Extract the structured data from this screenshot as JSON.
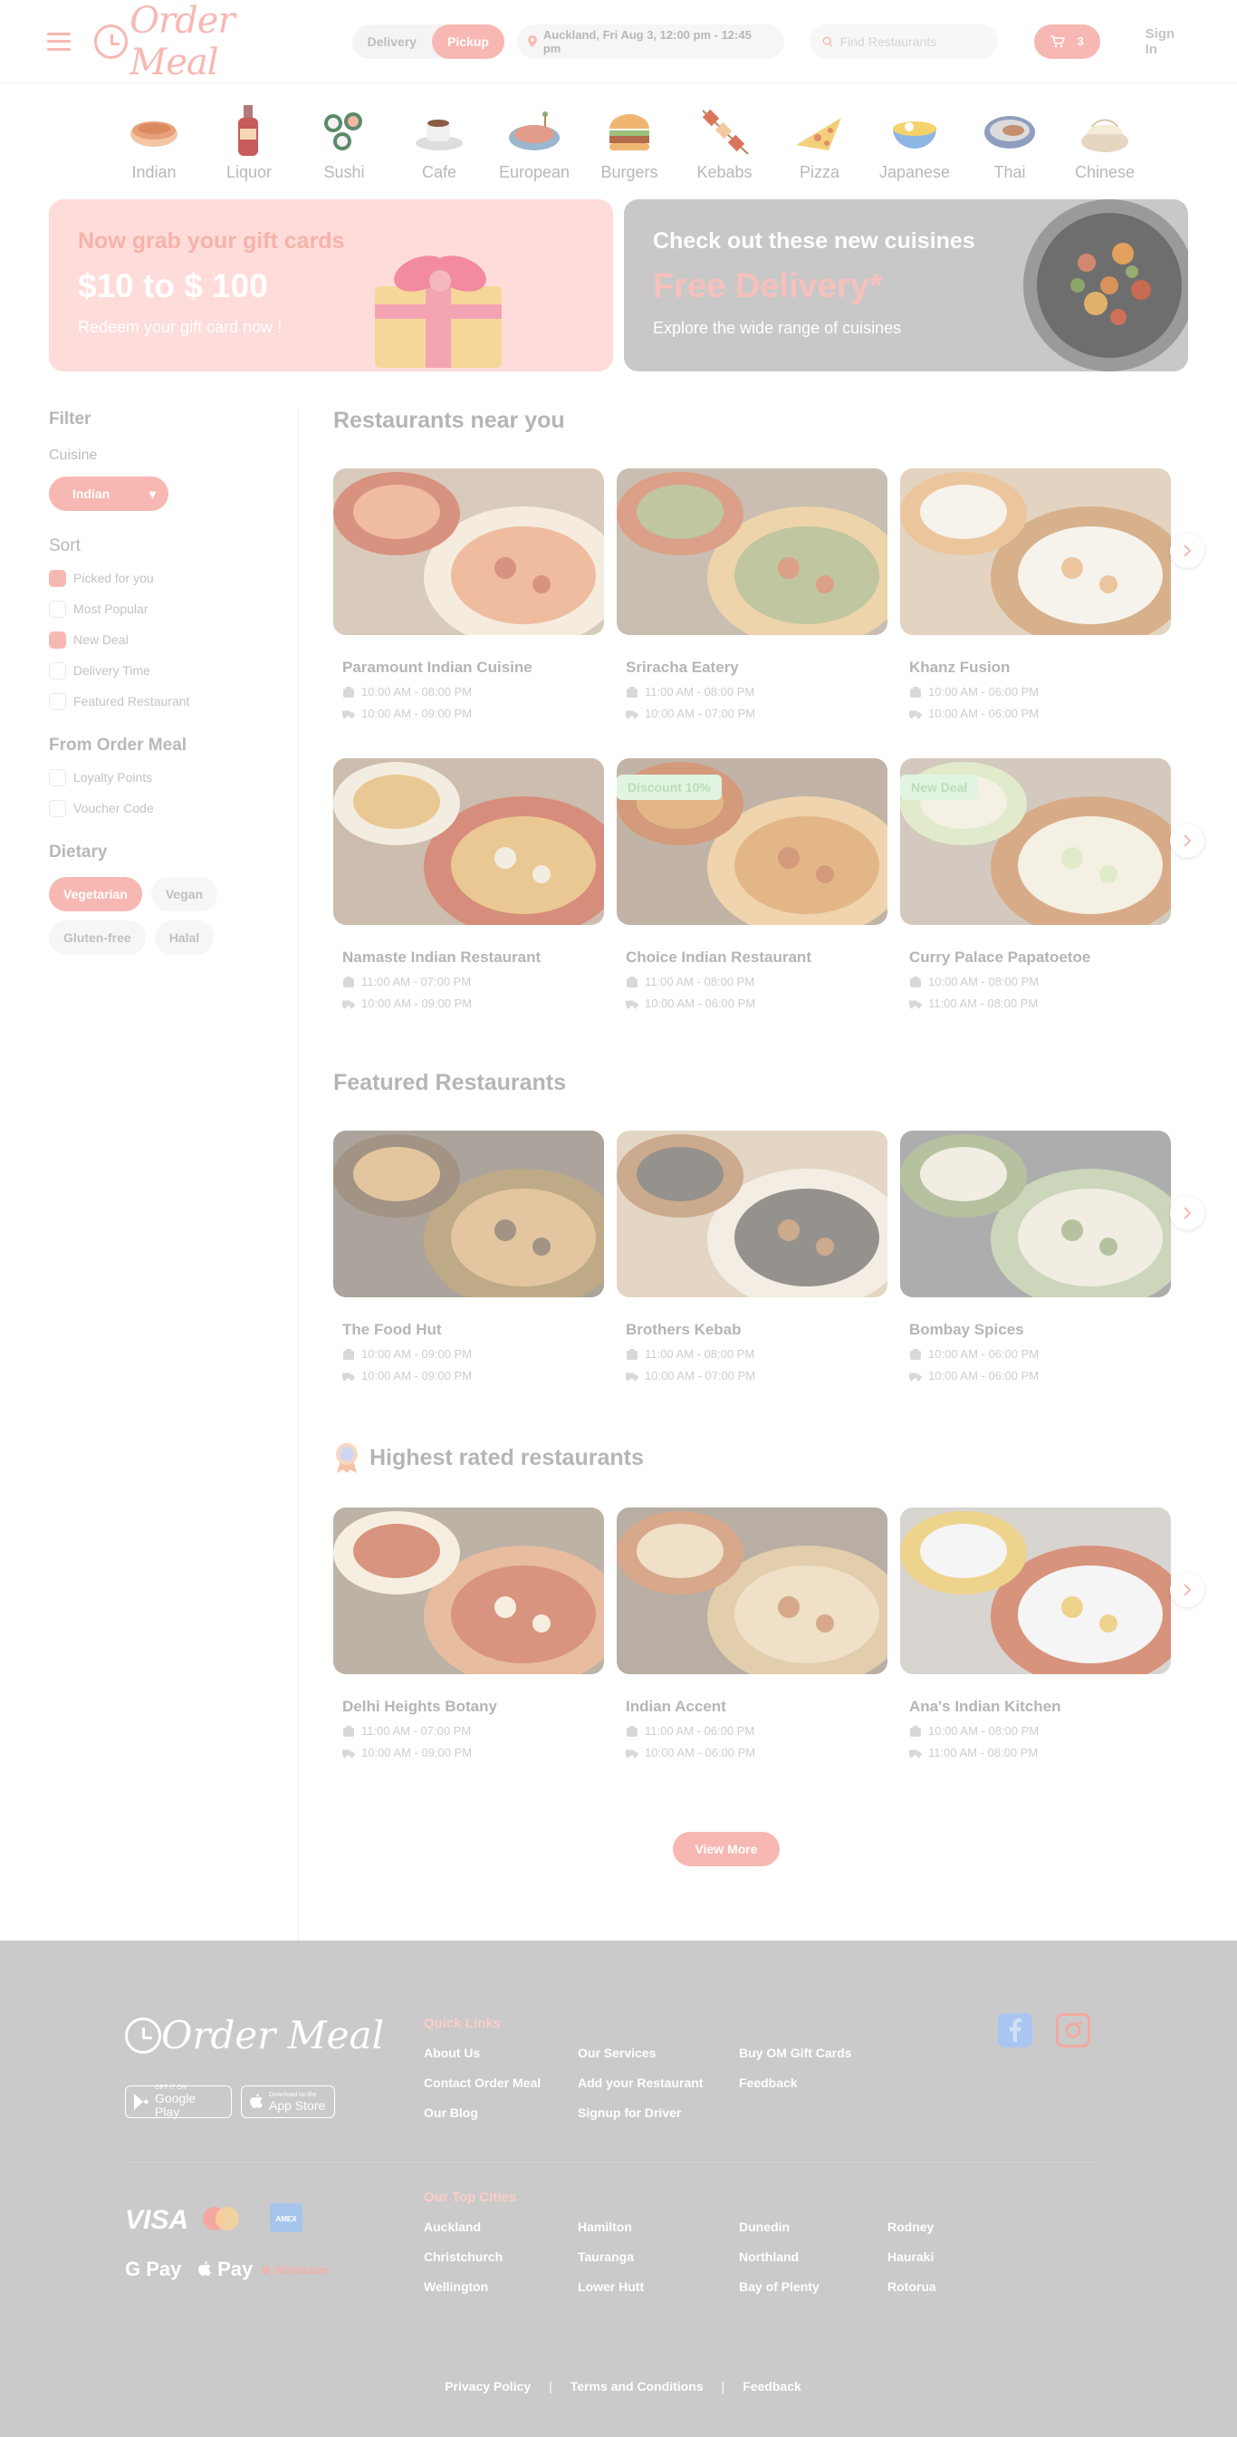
{
  "header": {
    "brand": "Order Meal",
    "delivery_label": "Delivery",
    "pickup_label": "Pickup",
    "location": "Auckland, Fri Aug 3, 12:00 pm - 12:45 pm",
    "search_placeholder": "Find Restaurants",
    "cart_count": "3",
    "signin_label": "Sign In"
  },
  "categories": [
    {
      "label": "Indian",
      "icon": "curry-bowl-icon"
    },
    {
      "label": "Liquor",
      "icon": "bottle-icon"
    },
    {
      "label": "Sushi",
      "icon": "sushi-icon"
    },
    {
      "label": "Cafe",
      "icon": "coffee-cup-icon"
    },
    {
      "label": "European",
      "icon": "european-dish-icon"
    },
    {
      "label": "Burgers",
      "icon": "burger-icon"
    },
    {
      "label": "Kebabs",
      "icon": "kebab-icon"
    },
    {
      "label": "Pizza",
      "icon": "pizza-icon"
    },
    {
      "label": "Japanese",
      "icon": "ramen-icon"
    },
    {
      "label": "Thai",
      "icon": "thai-dish-icon"
    },
    {
      "label": "Chinese",
      "icon": "dumpling-icon"
    }
  ],
  "banners": {
    "gift": {
      "title": "Now grab your gift cards",
      "amount": "$10 to $ 100",
      "cta": "Redeem your gift card now !"
    },
    "cuisine": {
      "title": "Check out these new cuisines",
      "headline": "Free Delivery*",
      "sub": "Explore the wide range of cuisines"
    }
  },
  "sidebar": {
    "filter_title": "Filter",
    "cuisine_label": "Cuisine",
    "cuisine_value": "Indian",
    "sort_title": "Sort",
    "sort_options": [
      {
        "label": "Picked for you",
        "checked": true
      },
      {
        "label": "Most Popular",
        "checked": false
      },
      {
        "label": "New Deal",
        "checked": true
      },
      {
        "label": "Delivery Time",
        "checked": false
      },
      {
        "label": "Featured Restaurant",
        "checked": false
      }
    ],
    "from_title": "From Order Meal",
    "from_options": [
      {
        "label": "Loyalty Points",
        "checked": false
      },
      {
        "label": "Voucher Code",
        "checked": false
      }
    ],
    "dietary_title": "Dietary",
    "dietary": [
      {
        "label": "Vegetarian",
        "active": true
      },
      {
        "label": "Vegan",
        "active": false
      },
      {
        "label": "Gluten-free",
        "active": false
      },
      {
        "label": "Halal",
        "active": false
      }
    ]
  },
  "sections": {
    "near_title": "Restaurants near you",
    "featured_title": "Featured Restaurants",
    "rated_title": "Highest rated restaurants",
    "view_more": "View More"
  },
  "near": [
    {
      "name": "Paramount Indian Cuisine",
      "pickup": "10:00 AM - 08:00 PM",
      "delivery": "10:00 AM - 09:00 PM",
      "tag": ""
    },
    {
      "name": "Sriracha Eatery",
      "pickup": "11:00 AM - 08:00 PM",
      "delivery": "10:00 AM - 07:00 PM",
      "tag": ""
    },
    {
      "name": "Khanz Fusion",
      "pickup": "10:00 AM - 06:00 PM",
      "delivery": "10:00 AM - 06:00 PM",
      "tag": ""
    },
    {
      "name": "Namaste Indian Restaurant",
      "pickup": "11:00 AM - 07:00 PM",
      "delivery": "10:00 AM - 09:00 PM",
      "tag": ""
    },
    {
      "name": "Choice Indian Restaurant",
      "pickup": "11:00 AM - 08:00 PM",
      "delivery": "10:00 AM - 06:00 PM",
      "tag": "Discount 10%"
    },
    {
      "name": "Curry Palace Papatoetoe",
      "pickup": "10:00 AM - 08:00 PM",
      "delivery": "11:00 AM - 08:00 PM",
      "tag": "New Deal"
    }
  ],
  "featured": [
    {
      "name": "The Food Hut",
      "pickup": "10:00 AM - 09:00 PM",
      "delivery": "10:00 AM - 09:00 PM"
    },
    {
      "name": "Brothers Kebab",
      "pickup": "11:00 AM - 08:00 PM",
      "delivery": "10:00 AM - 07:00 PM"
    },
    {
      "name": "Bombay Spices",
      "pickup": "10:00 AM - 06:00 PM",
      "delivery": "10:00 AM - 06:00 PM"
    }
  ],
  "rated": [
    {
      "name": "Delhi Heights Botany",
      "pickup": "11:00 AM - 07:00 PM",
      "delivery": "10:00 AM - 09:00 PM"
    },
    {
      "name": "Indian Accent",
      "pickup": "11:00 AM - 06:00 PM",
      "delivery": "10:00 AM - 06:00 PM"
    },
    {
      "name": "Ana's Indian Kitchen",
      "pickup": "10:00 AM - 08:00 PM",
      "delivery": "11:00 AM - 08:00 PM"
    }
  ],
  "footer": {
    "brand": "Order Meal",
    "google_small": "GET IT ON",
    "google_big": "Google Play",
    "apple_small": "Download on the",
    "apple_big": "App Store",
    "quick_links_title": "Quick Links",
    "quick_links": [
      "About Us",
      "Our Services",
      "Buy OM Gift Cards",
      "Contact Order Meal",
      "Add your Restaurant",
      "Feedback",
      "Our Blog",
      "Signup for Driver"
    ],
    "cities_title": "Our Top Cities",
    "cities": [
      "Auckland",
      "Hamilton",
      "Dunedin",
      "Rodney",
      "Christchurch",
      "Tauranga",
      "Northland",
      "Hauraki",
      "Wellington",
      "Lower Hutt",
      "Bay of Plenty",
      "Rotorua"
    ],
    "payments": [
      "VISA",
      "G Pay",
      "Pay",
      "Windcave"
    ],
    "legal": [
      "Privacy Policy",
      "Terms and Conditions",
      "Feedback"
    ]
  },
  "colors": {
    "accent": "#f7b8b3",
    "footer_bg": "#cacaca",
    "muted_text": "#b9b9b9"
  }
}
